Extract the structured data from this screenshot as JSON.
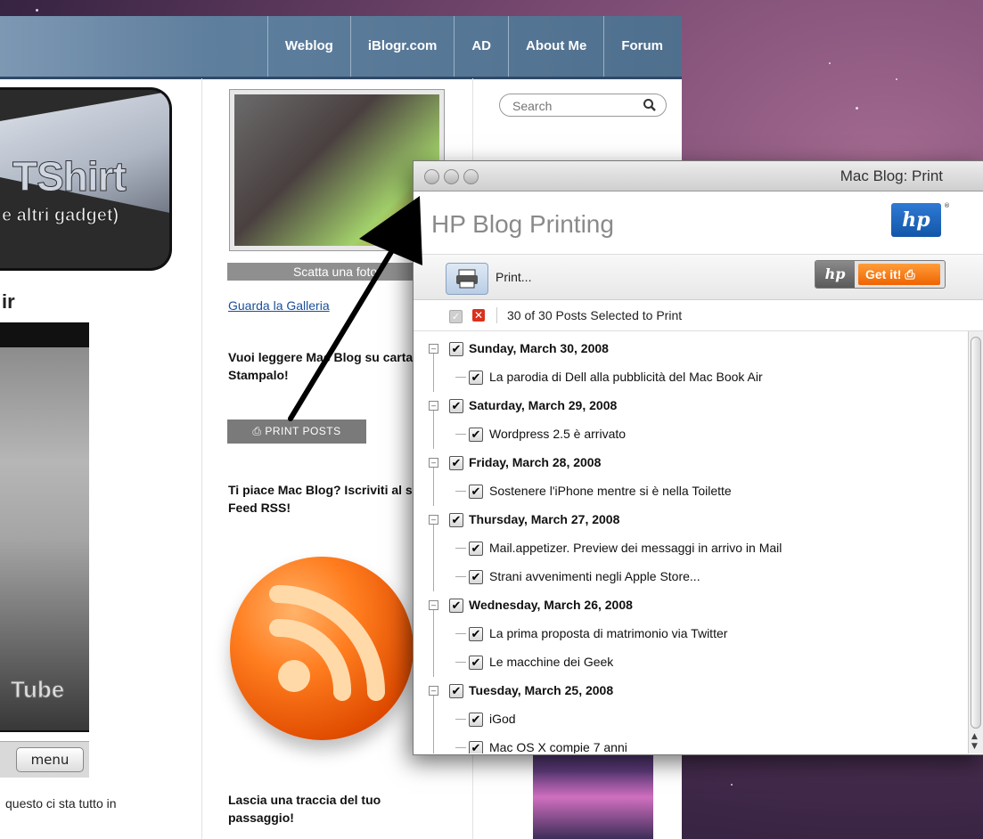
{
  "blog": {
    "nav": [
      "Weblog",
      "iBlogr.com",
      "AD",
      "About Me",
      "Forum"
    ],
    "banner_title": "TShirt",
    "banner_subtitle": "e altri gadget)",
    "left_heading": "ir",
    "youtube_logo": "Tube",
    "menu_button": "menu",
    "left_caption": "questo ci sta tutto in",
    "photo_caption": "Scatta una foto!",
    "gallery_link": "Guarda la Galleria",
    "print_prompt": "Vuoi leggere Mac Blog su carta? Stampalo!",
    "print_posts_button": "PRINT POSTS",
    "rss_prompt": "Ti piace Mac Blog? Iscriviti al suo Feed RSS!",
    "trace_prompt": "Lascia una traccia del tuo passaggio!",
    "search_placeholder": "Search"
  },
  "window": {
    "title": "Mac Blog: Print",
    "app_title": "HP Blog Printing",
    "hp_logo": "hp",
    "print_label": "Print...",
    "get_it": "Get it!",
    "selection_text": "30 of 30 Posts Selected to Print",
    "tree": [
      {
        "day": "Sunday, March 30, 2008",
        "posts": [
          "La parodia di Dell alla pubblicità del Mac Book Air"
        ]
      },
      {
        "day": "Saturday, March 29, 2008",
        "posts": [
          "Wordpress 2.5 è arrivato"
        ]
      },
      {
        "day": "Friday, March 28, 2008",
        "posts": [
          "Sostenere l'iPhone mentre si è nella Toilette"
        ]
      },
      {
        "day": "Thursday, March 27, 2008",
        "posts": [
          "Mail.appetizer. Preview dei messaggi in arrivo in Mail",
          "Strani avvenimenti negli Apple Store..."
        ]
      },
      {
        "day": "Wednesday, March 26, 2008",
        "posts": [
          "La prima proposta di matrimonio via Twitter",
          "Le macchine dei Geek"
        ]
      },
      {
        "day": "Tuesday, March 25, 2008",
        "posts": [
          "iGod",
          "Mac OS X compie 7 anni"
        ]
      }
    ]
  },
  "colors": {
    "nav_bg": "#5f7f9e",
    "get_it_orange": "#ee6400",
    "hp_blue": "#1256a8",
    "link_blue": "#1a4f9a"
  }
}
